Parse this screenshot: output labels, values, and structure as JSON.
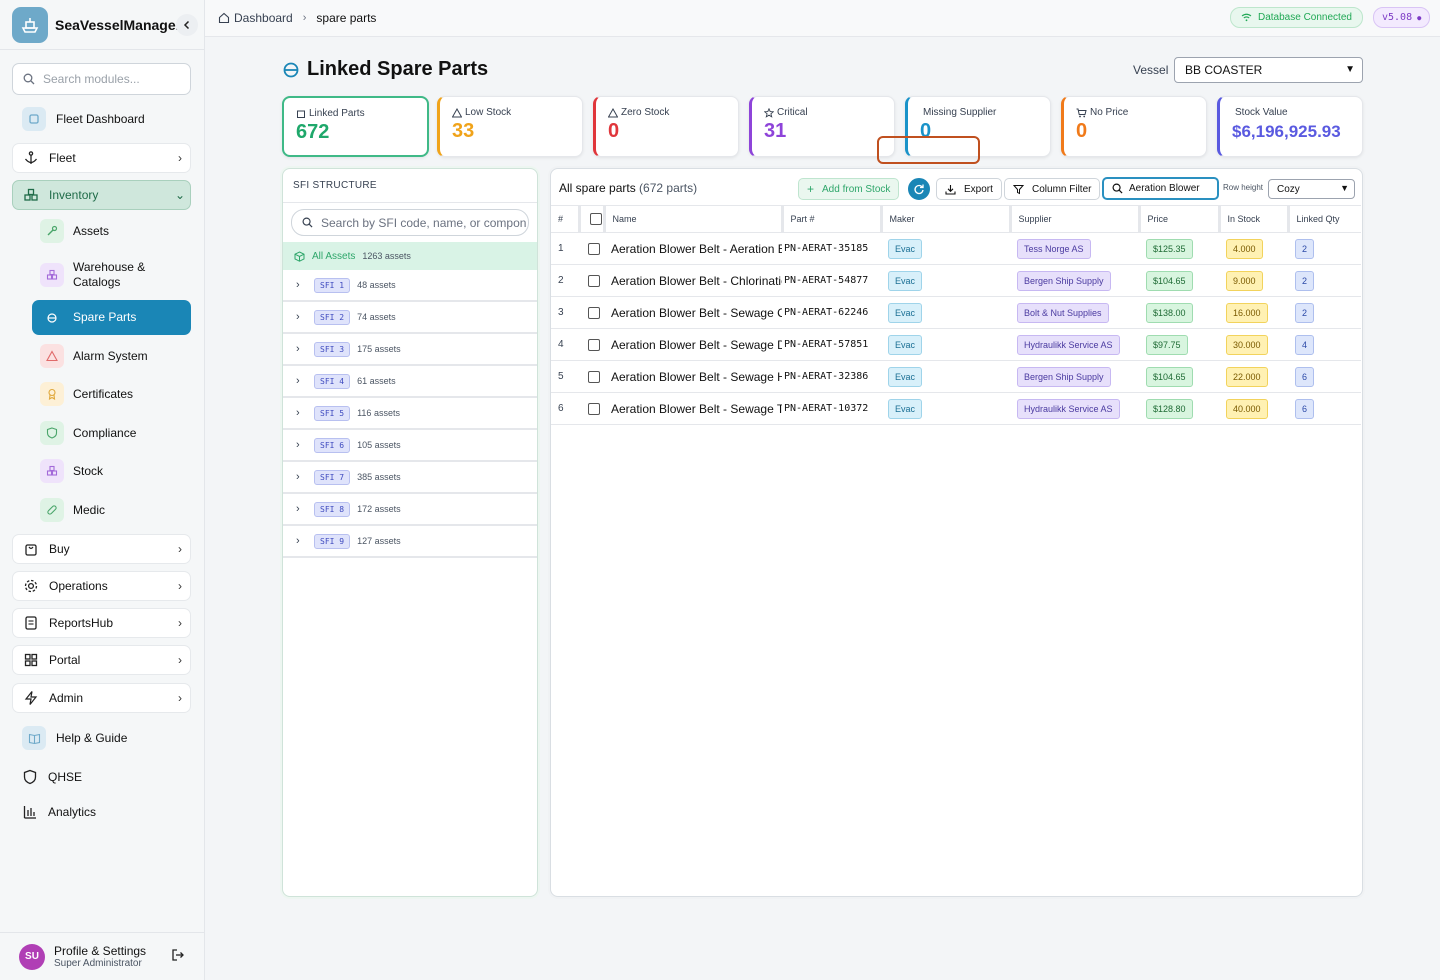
{
  "app": {
    "name": "SeaVesselManager",
    "search_placeholder": "Search modules..."
  },
  "nav": {
    "fleet_dashboard": "Fleet Dashboard",
    "fleet": "Fleet",
    "inventory": "Inventory",
    "sub": {
      "assets": "Assets",
      "warehouse_line1": "Warehouse &",
      "warehouse_line2": "Catalogs",
      "spare_parts": "Spare Parts",
      "alarm_system": "Alarm System",
      "certificates": "Certificates",
      "compliance": "Compliance",
      "stock": "Stock",
      "medic": "Medic"
    },
    "buy": "Buy",
    "operations": "Operations",
    "reportshub": "ReportsHub",
    "portal": "Portal",
    "admin": "Admin",
    "help": "Help & Guide",
    "qhse": "QHSE",
    "analytics": "Analytics"
  },
  "profile": {
    "initials": "SU",
    "name": "Profile & Settings",
    "role": "Super Administrator"
  },
  "topbar": {
    "crumb_home": "Dashboard",
    "crumb_current": "spare parts",
    "db_status": "Database Connected",
    "version": "v5.08"
  },
  "page": {
    "title": "Linked Spare Parts",
    "vessel_label": "Vessel",
    "vessel_value": "BB COASTER"
  },
  "stats": [
    {
      "label": "Linked Parts",
      "value": "672",
      "color": "#1fa86b"
    },
    {
      "label": "Low Stock",
      "value": "33",
      "color": "#f0a31a"
    },
    {
      "label": "Zero Stock",
      "value": "0",
      "color": "#e0363b"
    },
    {
      "label": "Critical",
      "value": "31",
      "color": "#8e44d9"
    },
    {
      "label": "Missing Supplier",
      "value": "0",
      "color": "#1a93c9"
    },
    {
      "label": "No Price",
      "value": "0",
      "color": "#f07a1a"
    },
    {
      "label": "Stock Value",
      "value": "$6,196,925.93",
      "color": "#5a5ae0"
    }
  ],
  "sfi": {
    "header": "SFI STRUCTURE",
    "search_placeholder": "Search by SFI code, name, or compon",
    "all_label": "All Assets",
    "all_count": "1263 assets",
    "groups": [
      {
        "code": "SFI 1",
        "count": "48 assets"
      },
      {
        "code": "SFI 2",
        "count": "74 assets"
      },
      {
        "code": "SFI 3",
        "count": "175 assets"
      },
      {
        "code": "SFI 4",
        "count": "61 assets"
      },
      {
        "code": "SFI 5",
        "count": "116 assets"
      },
      {
        "code": "SFI 6",
        "count": "105 assets"
      },
      {
        "code": "SFI 7",
        "count": "385 assets"
      },
      {
        "code": "SFI 8",
        "count": "172 assets"
      },
      {
        "code": "SFI 9",
        "count": "127 assets"
      }
    ]
  },
  "parts": {
    "title": "All spare parts",
    "subtitle": "(672 parts)",
    "add_label": "Add from Stock",
    "export_label": "Export",
    "column_filter_label": "Column Filter",
    "search_value": "Aeration Blower",
    "row_height_label": "Row height",
    "row_height_value": "Cozy",
    "columns": [
      "#",
      "",
      "Name",
      "Part #",
      "Maker",
      "Supplier",
      "Price",
      "In Stock",
      "Linked Qty"
    ],
    "rows": [
      {
        "n": "1",
        "name": "Aeration Blower Belt - Aeration B",
        "part": "PN-AERAT-35185",
        "maker": "Evac",
        "supplier": "Tess Norge AS",
        "price": "$125.35",
        "stock": "4.000",
        "qty": "2"
      },
      {
        "n": "2",
        "name": "Aeration Blower Belt - Chlorinatic",
        "part": "PN-AERAT-54877",
        "maker": "Evac",
        "supplier": "Bergen Ship Supply",
        "price": "$104.65",
        "stock": "9.000",
        "qty": "2"
      },
      {
        "n": "3",
        "name": "Aeration Blower Belt - Sewage C",
        "part": "PN-AERAT-62246",
        "maker": "Evac",
        "supplier": "Bolt & Nut Supplies",
        "price": "$138.00",
        "stock": "16.000",
        "qty": "2"
      },
      {
        "n": "4",
        "name": "Aeration Blower Belt - Sewage D",
        "part": "PN-AERAT-57851",
        "maker": "Evac",
        "supplier": "Hydraulikk Service AS",
        "price": "$97.75",
        "stock": "30.000",
        "qty": "4"
      },
      {
        "n": "5",
        "name": "Aeration Blower Belt - Sewage H",
        "part": "PN-AERAT-32386",
        "maker": "Evac",
        "supplier": "Bergen Ship Supply",
        "price": "$104.65",
        "stock": "22.000",
        "qty": "6"
      },
      {
        "n": "6",
        "name": "Aeration Blower Belt - Sewage Tr",
        "part": "PN-AERAT-10372",
        "maker": "Evac",
        "supplier": "Hydraulikk Service AS",
        "price": "$128.80",
        "stock": "40.000",
        "qty": "6"
      }
    ]
  }
}
